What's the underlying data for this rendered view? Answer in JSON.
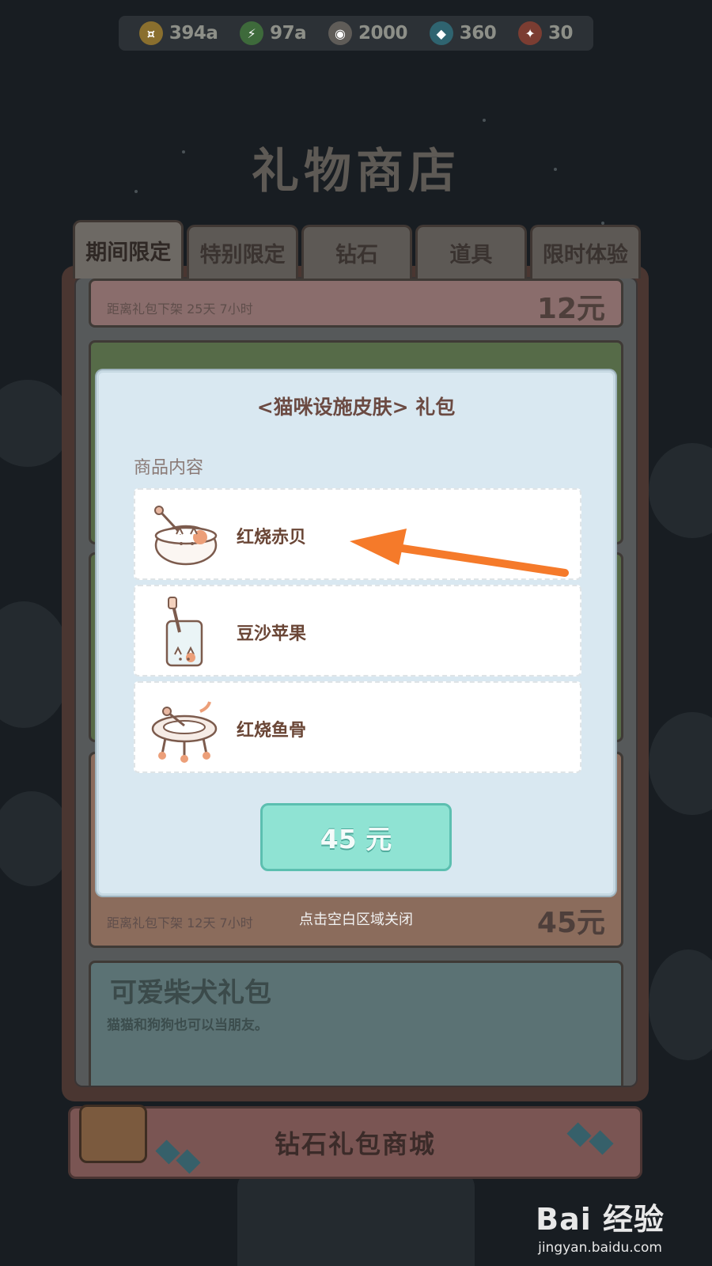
{
  "currency_bar": {
    "gold": "394a",
    "energy": "97a",
    "cans": "2000",
    "diamonds": "360",
    "tickets": "30"
  },
  "shop": {
    "title": "礼物商店",
    "tabs": [
      "期间限定",
      "特别限定",
      "钻石",
      "道具",
      "限时体验"
    ],
    "cards": {
      "top_countdown": "距离礼包下架 25天 7小时",
      "top_price": "12元",
      "orange_countdown": "距离礼包下架 12天 7小时",
      "orange_price": "45元",
      "teal_title": "可爱柴犬礼包",
      "teal_subtitle": "猫猫和狗狗也可以当朋友。"
    },
    "diamond_banner": "钻石礼包商城"
  },
  "modal": {
    "title": "<猫咪设施皮肤> 礼包",
    "section_label": "商品内容",
    "items": [
      {
        "name": "红烧赤贝",
        "icon": "cat-bowl-icon"
      },
      {
        "name": "豆沙苹果",
        "icon": "cat-cup-icon"
      },
      {
        "name": "红烧鱼骨",
        "icon": "cat-bed-icon"
      }
    ],
    "price_button": "45 元",
    "close_hint": "点击空白区域关闭"
  },
  "colors": {
    "modal_bg": "#d9e8f1",
    "button_bg": "#8fe3d3",
    "arrow": "#f57a2a"
  },
  "watermark": {
    "logo": "Bai 经验",
    "url": "jingyan.baidu.com"
  }
}
